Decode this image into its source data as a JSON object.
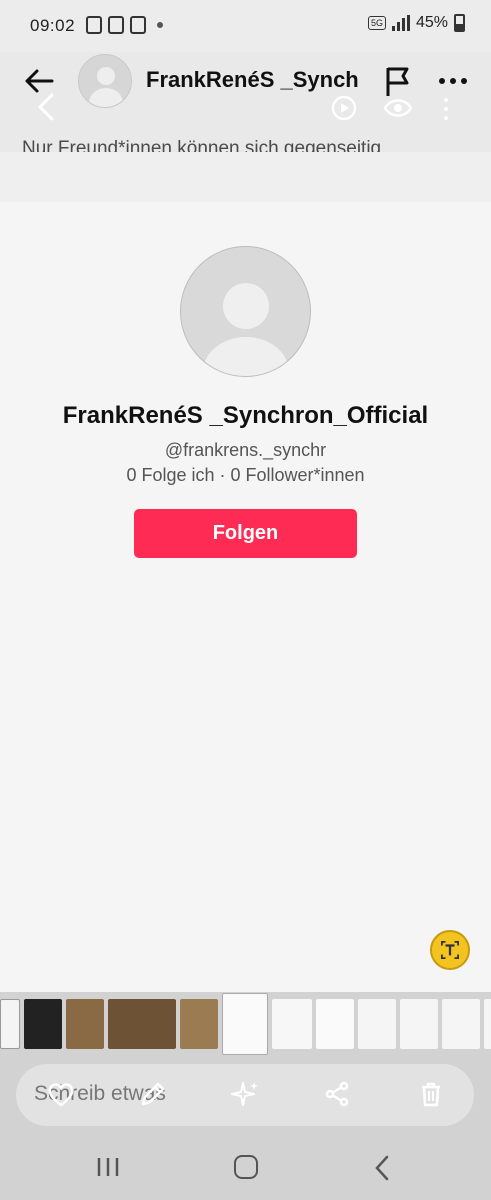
{
  "status_bar": {
    "time": "09:02",
    "battery": "45%",
    "network": "5G"
  },
  "header": {
    "username": "FrankRenéS _Synchron_Official",
    "notice": "Nur Freund*innen können sich gegenseitig Nachrichten schicken"
  },
  "profile": {
    "display_name": "FrankRenéS _Synchron_Official",
    "handle": "@frankrens._synchr",
    "stats": "0 Folge ich · 0 Follower*innen",
    "follow_label": "Folgen"
  },
  "composer": {
    "placeholder": "Schreib etwas"
  },
  "colors": {
    "follow_button": "#fe2c55",
    "ai_button": "#f3c322",
    "toolbar_bg": "#d2d2d2"
  },
  "icons": [
    "back-icon",
    "flag-icon",
    "more-icon",
    "play-icon",
    "eye-icon",
    "ai-text-icon",
    "heart-icon",
    "pencil-icon",
    "sparkle-icon",
    "share-icon",
    "trash-icon",
    "recent-apps-icon",
    "home-icon",
    "nav-back-icon"
  ]
}
